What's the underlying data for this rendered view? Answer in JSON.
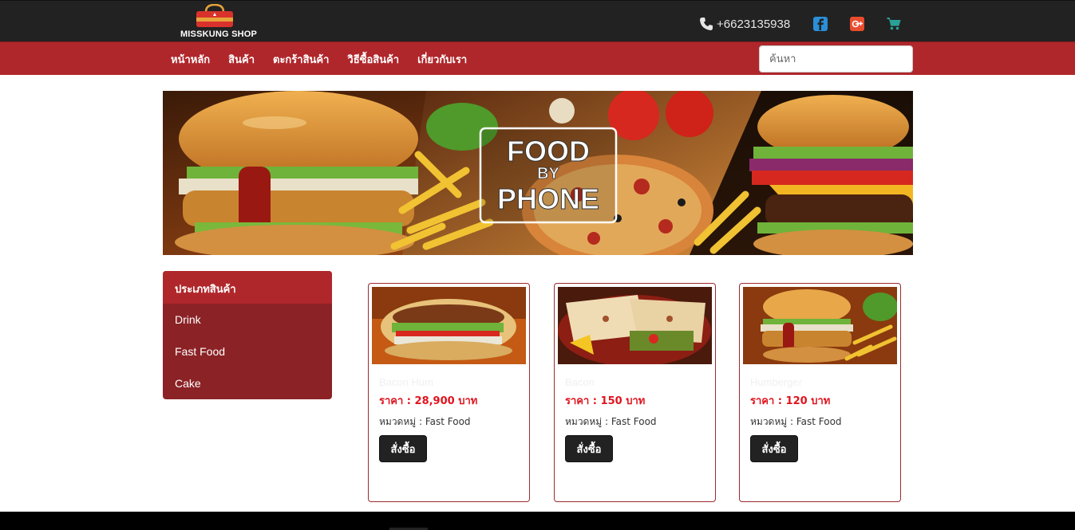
{
  "header": {
    "logo_text": "MISSKUNG SHOP",
    "phone": "+6623135938",
    "icons": [
      "phone-icon",
      "facebook-icon",
      "google-plus-icon",
      "cart-icon"
    ],
    "colors": {
      "bar": "#222222",
      "facebook": "#2a8fd8",
      "google_plus": "#ea4c2e",
      "cart": "#2aa198"
    }
  },
  "nav": {
    "items": [
      "หน้าหลัก",
      "สินค้า",
      "ตะกร้าสินค้า",
      "วิธีซื้อสินค้า",
      "เกี่ยวกับเรา"
    ],
    "search_placeholder": "ค้นหา",
    "color": "#b0272b"
  },
  "banner": {
    "line1": "FOOD",
    "line2": "BY",
    "line3": "PHONE"
  },
  "sidebar": {
    "title": "ประเภทสินค้า",
    "items": [
      "Drink",
      "Fast Food",
      "Cake"
    ]
  },
  "products": [
    {
      "name": "Bacon Hum",
      "price": "ราคา : 28,900 บาท",
      "category": "หมวดหมู่ : Fast Food",
      "button": "สั่งซื้อ"
    },
    {
      "name": "Bacon",
      "price": "ราคา : 150 บาท",
      "category": "หมวดหมู่ : Fast Food",
      "button": "สั่งซื้อ"
    },
    {
      "name": "Humberger",
      "price": "ราคา : 120 บาท",
      "category": "หมวดหมู่ : Fast Food",
      "button": "สั่งซื้อ"
    }
  ]
}
